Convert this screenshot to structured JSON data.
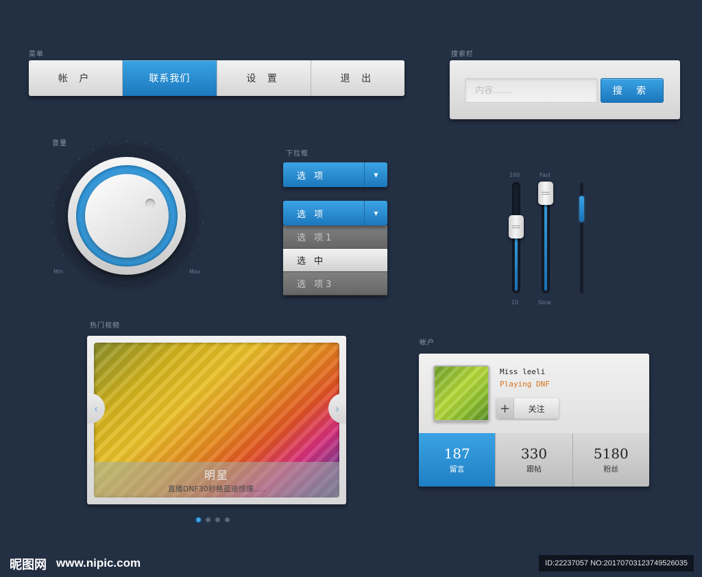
{
  "menu": {
    "label": "菜单",
    "items": [
      {
        "label": "帐 户"
      },
      {
        "label": "联系我们"
      },
      {
        "label": "设 置"
      },
      {
        "label": "退 出"
      }
    ],
    "active_index": 1
  },
  "search": {
    "label": "搜索栏",
    "placeholder": "内容.......",
    "button_label": "搜 索"
  },
  "volume": {
    "label": "音量",
    "min_label": "Min",
    "max_label": "Max"
  },
  "dropdown": {
    "label": "下拉框",
    "closed_label": "选 项",
    "open_label": "选 项",
    "options": [
      {
        "label": "选 项1",
        "state": "normal"
      },
      {
        "label": "选 中",
        "state": "selected"
      },
      {
        "label": "选 项3",
        "state": "normal"
      }
    ]
  },
  "sliders": {
    "slider1": {
      "top_label": "100",
      "bottom_label": "10",
      "level": 0.6
    },
    "slider2": {
      "top_label": "Fast",
      "bottom_label": "Slow",
      "level": 0.9
    },
    "slider3": {
      "level": 0.75
    }
  },
  "hot_videos": {
    "label": "热门视频",
    "title": "明星",
    "subtitle": "直播DNF30秒格蓝迪惊爆.....",
    "prev_icon": "chevron-left-icon",
    "next_icon": "chevron-right-icon",
    "page_count": 4,
    "active_page": 1
  },
  "account": {
    "label": "帐户",
    "name": "Miss leeli",
    "status": "Playing DNF",
    "follow_label": "关注",
    "stats": [
      {
        "value": "187",
        "label": "留言"
      },
      {
        "value": "330",
        "label": "跟帖"
      },
      {
        "value": "5180",
        "label": "粉丝"
      }
    ]
  },
  "watermark": {
    "logo": "昵图网",
    "url": "www.nipic.com",
    "id_text": "ID:22237057 NO:20170703123749526035"
  },
  "colors": {
    "background": "#232f43",
    "accent_blue": "#2a8fd6",
    "status_orange": "#d8731f"
  }
}
